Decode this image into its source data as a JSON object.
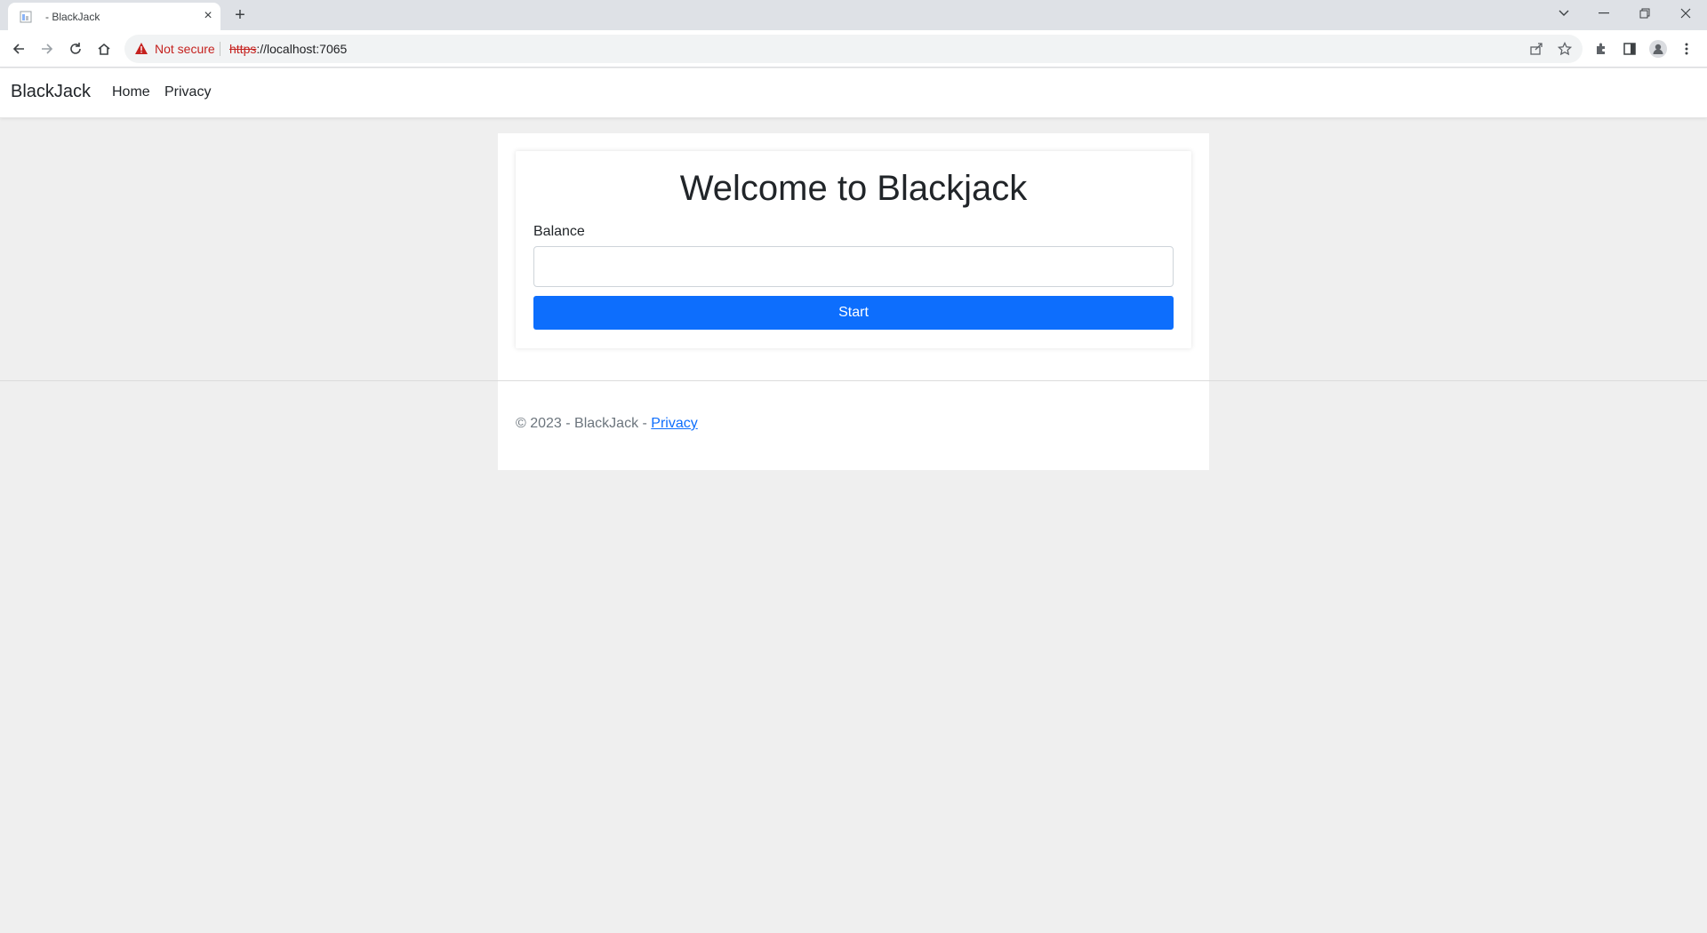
{
  "browser": {
    "tab_title": "- BlackJack",
    "security_label": "Not secure",
    "url_scheme": "https",
    "url_rest": "://localhost:7065"
  },
  "navbar": {
    "brand": "BlackJack",
    "links": [
      "Home",
      "Privacy"
    ]
  },
  "main": {
    "title": "Welcome to Blackjack",
    "balance_label": "Balance",
    "balance_value": "",
    "start_label": "Start"
  },
  "footer": {
    "text": "© 2023 - BlackJack - ",
    "privacy_link": "Privacy"
  },
  "colors": {
    "primary": "#0d6efd",
    "page_bg": "#efefef",
    "warning": "#c5221f"
  }
}
